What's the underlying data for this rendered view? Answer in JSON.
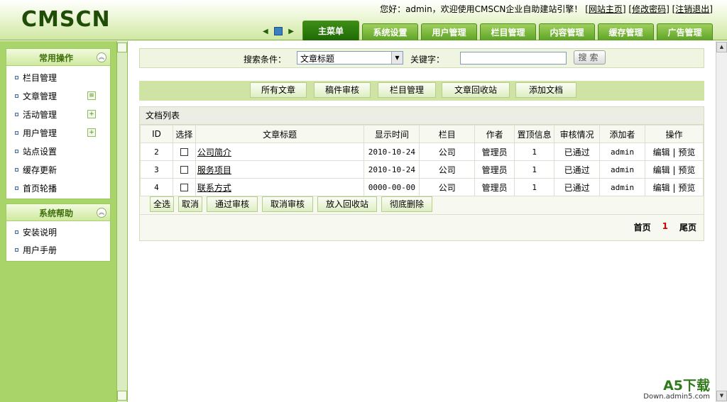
{
  "app": {
    "logo": "CMSCN"
  },
  "header": {
    "welcome_text": "您好：admin，欢迎使用CMSCN企业自助建站引擎！",
    "links": [
      "[网站主页]",
      "[修改密码]",
      "[注销退出]"
    ]
  },
  "tabs": [
    "主菜单",
    "系统设置",
    "用户管理",
    "栏目管理",
    "内容管理",
    "缓存管理",
    "广告管理"
  ],
  "sidebar": {
    "panels": [
      {
        "title": "常用操作",
        "items": [
          "栏目管理",
          "文章管理",
          "活动管理",
          "用户管理",
          "站点设置",
          "缓存更新",
          "首页轮播"
        ]
      },
      {
        "title": "系统帮助",
        "items": [
          "安装说明",
          "用户手册"
        ]
      }
    ]
  },
  "search": {
    "condition_label": "搜索条件：",
    "condition_value": "文章标题",
    "keyword_label": "关键字：",
    "keyword_value": "",
    "button": "搜索"
  },
  "actions": [
    "所有文章",
    "稿件审核",
    "栏目管理",
    "文章回收站",
    "添加文档"
  ],
  "list": {
    "title": "文档列表",
    "columns": [
      "ID",
      "选择",
      "文章标题",
      "显示时间",
      "栏目",
      "作者",
      "置顶信息",
      "审核情况",
      "添加者",
      "操作"
    ],
    "rows": [
      {
        "id": "2",
        "title": "公司简介",
        "date": "2010-10-24",
        "category": "公司",
        "author": "管理员",
        "top": "1",
        "status": "已通过",
        "adder": "admin",
        "edit": "编辑",
        "sep": "|",
        "preview": "预览"
      },
      {
        "id": "3",
        "title": "服务项目",
        "date": "2010-10-24",
        "category": "公司",
        "author": "管理员",
        "top": "1",
        "status": "已通过",
        "adder": "admin",
        "edit": "编辑",
        "sep": "|",
        "preview": "预览"
      },
      {
        "id": "4",
        "title": "联系方式",
        "date": "0000-00-00",
        "category": "公司",
        "author": "管理员",
        "top": "1",
        "status": "已通过",
        "adder": "admin",
        "edit": "编辑",
        "sep": "|",
        "preview": "预览"
      }
    ],
    "batch_buttons": [
      "全选",
      "取消",
      "通过审核",
      "取消审核",
      "放入回收站",
      "彻底删除"
    ],
    "pager": {
      "first": "首页",
      "current": "1",
      "last": "尾页"
    }
  },
  "watermark": {
    "brand": "A5下载",
    "url": "Down.admin5.com"
  }
}
